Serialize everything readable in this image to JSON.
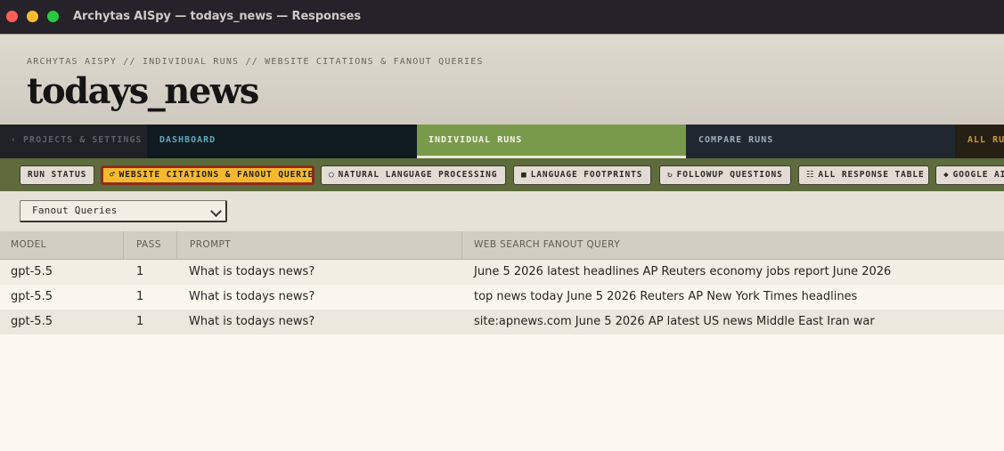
{
  "window": {
    "title": "Archytas AISpy — todays_news — Responses"
  },
  "header": {
    "breadcrumb": "ARCHYTAS AISPY // INDIVIDUAL RUNS // WEBSITE CITATIONS & FANOUT QUERIES",
    "title": "todays_news"
  },
  "main_nav": {
    "tabs": [
      {
        "label": "‹ PROJECTS & SETTINGS",
        "state": "inactive"
      },
      {
        "label": "DASHBOARD",
        "state": "inactive"
      },
      {
        "label": "INDIVIDUAL RUNS",
        "state": "active"
      },
      {
        "label": "COMPARE RUNS",
        "state": "inactive"
      },
      {
        "label": "ALL RUNS",
        "state": "inactive"
      }
    ]
  },
  "sub_nav": {
    "items": [
      {
        "icon": "",
        "label": "RUN STATUS"
      },
      {
        "icon": "♂",
        "label": "WEBSITE CITATIONS & FANOUT QUERIES"
      },
      {
        "icon": "○",
        "label": "NATURAL LANGUAGE PROCESSING"
      },
      {
        "icon": "■",
        "label": "LANGUAGE FOOTPRINTS"
      },
      {
        "icon": "↻",
        "label": "FOLLOWUP QUESTIONS"
      },
      {
        "icon": "☷",
        "label": "ALL RESPONSE TABLE"
      },
      {
        "icon": "◆",
        "label": "GOOGLE AI"
      }
    ]
  },
  "controls": {
    "view_select": {
      "value": "Fanout Queries"
    }
  },
  "table": {
    "columns": [
      "MODEL",
      "PASS",
      "PROMPT",
      "WEB SEARCH FANOUT QUERY"
    ],
    "rows": [
      [
        "gpt-5.5",
        "1",
        "What is todays news?",
        "June 5 2026 latest headlines AP Reuters economy jobs report June 2026"
      ],
      [
        "gpt-5.5",
        "1",
        "What is todays news?",
        "top news today June 5 2026 Reuters AP New York Times headlines"
      ],
      [
        "gpt-5.5",
        "1",
        "What is todays news?",
        "site:apnews.com June 5 2026 AP latest US news Middle East Iran war"
      ]
    ]
  },
  "colors": {
    "titlebar": "#25222a",
    "main_nav_bg": "#1d2327",
    "active_tab": "#7a9a4b",
    "sub_nav_bg": "#5e6b3c",
    "active_pill": "#f5b930",
    "active_pill_border": "#8d2c1b",
    "page_bg": "#fbf9ef"
  }
}
